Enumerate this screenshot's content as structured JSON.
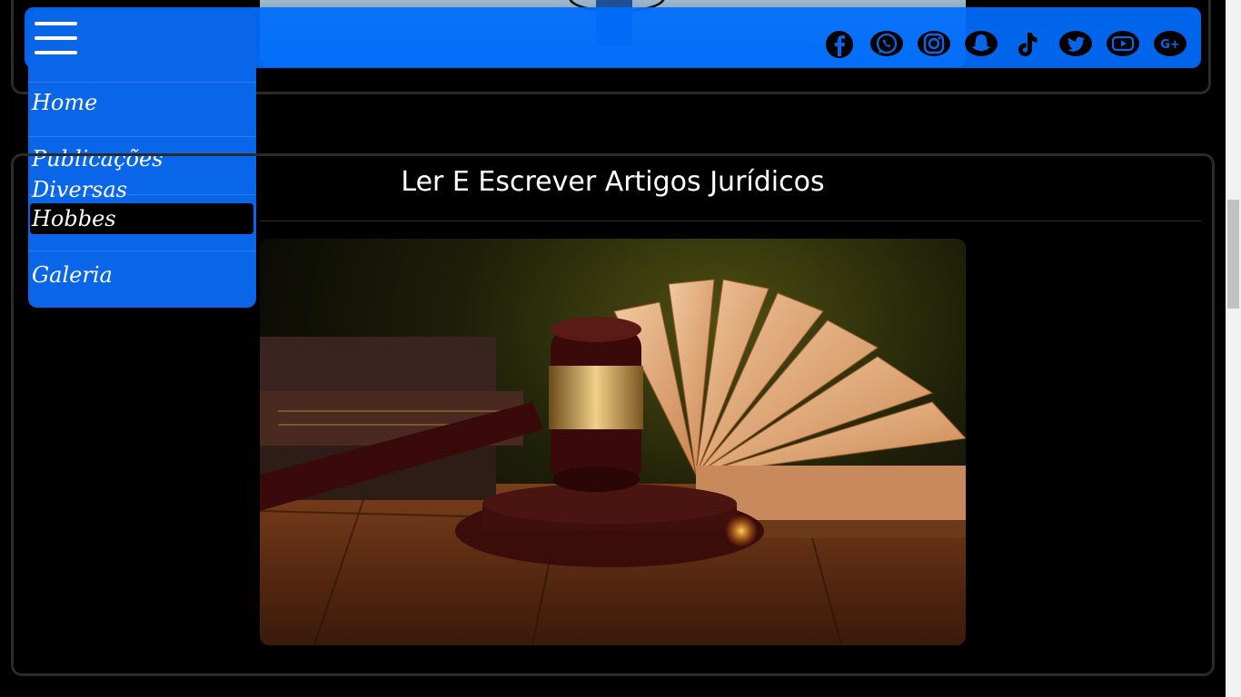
{
  "menu": {
    "items": [
      {
        "label": "Home"
      },
      {
        "label": "Publicações Diversas"
      },
      {
        "label": "Hobbes",
        "active": true
      },
      {
        "label": "Galeria"
      }
    ]
  },
  "social_icons": [
    "facebook-icon",
    "whatsapp-icon",
    "instagram-icon",
    "snapchat-icon",
    "tiktok-icon",
    "twitter-icon",
    "youtube-icon",
    "google-plus-icon"
  ],
  "article": {
    "title": "Ler E Escrever Artigos Jurídicos"
  },
  "colors": {
    "header_blue": "#006eff",
    "sidebar_blue": "#0a66e8",
    "background": "#000000",
    "text": "#ffffff"
  }
}
